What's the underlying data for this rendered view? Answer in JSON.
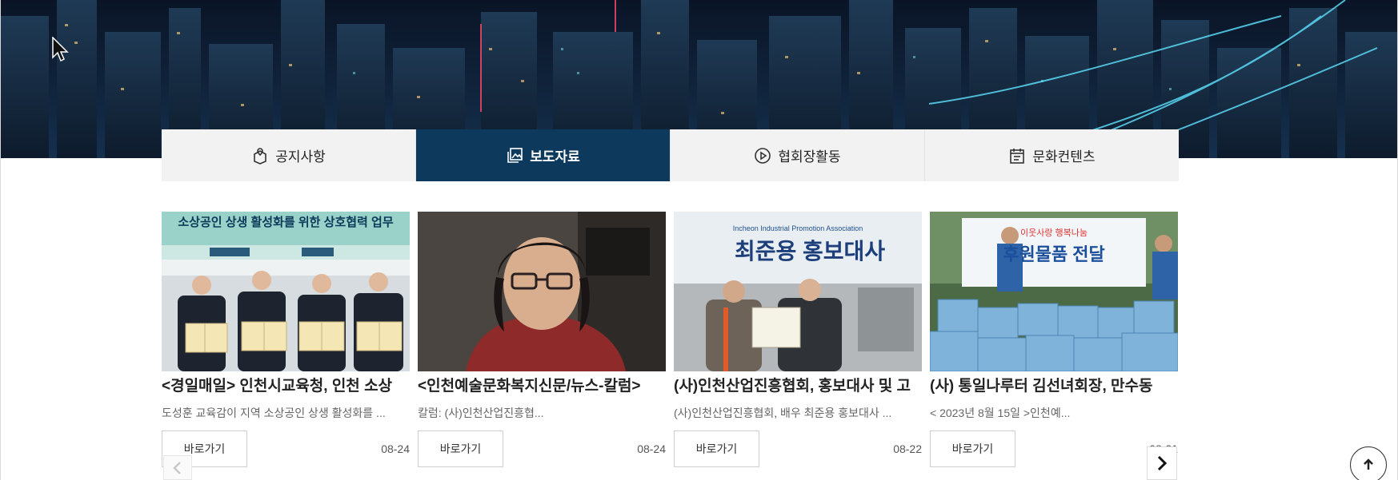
{
  "tabs": [
    {
      "label": "공지사항",
      "icon": "box-location-icon",
      "active": false
    },
    {
      "label": "보도자료",
      "icon": "gallery-icon",
      "active": true
    },
    {
      "label": "협회장활동",
      "icon": "play-circle-icon",
      "active": false
    },
    {
      "label": "문화컨텐츠",
      "icon": "calendar-icon",
      "active": false
    }
  ],
  "cards": [
    {
      "title": "<경일매일> 인천시교육청, 인천 소상",
      "desc": "도성훈 교육감이 지역 소상공인 상생 활성화를 ...",
      "button": "바로가기",
      "date": "08-24",
      "photo_banner": "소상공인 상생 활성화를 위한 상호협력 업무"
    },
    {
      "title": "<인천예술문화복지신문/뉴스-칼럼>",
      "desc": "칼럼: (사)인천산업진흥협...",
      "button": "바로가기",
      "date": "08-24"
    },
    {
      "title": "(사)인천산업진흥협회, 홍보대사 및 고",
      "desc": "(사)인천산업진흥협회, 배우 최준용 홍보대사 ...",
      "button": "바로가기",
      "date": "08-22",
      "photo_banner": "최준용 홍보대사",
      "photo_sub": "Incheon Industrial Promotion Association"
    },
    {
      "title": "(사) 통일나루터 김선녀회장, 만수동",
      "desc": "< 2023년 8월 15일 >인천예...",
      "button": "바로가기",
      "date": "08-21",
      "photo_banner": "후원물품 전달",
      "photo_sub": "이웃사랑 행복나눔"
    }
  ],
  "colors": {
    "active_tab": "#0d3a5c",
    "tab_bg": "#f2f2f2"
  },
  "controls": {
    "prev": "chevron-left-icon",
    "next": "chevron-right-icon",
    "top": "arrow-up-icon"
  }
}
